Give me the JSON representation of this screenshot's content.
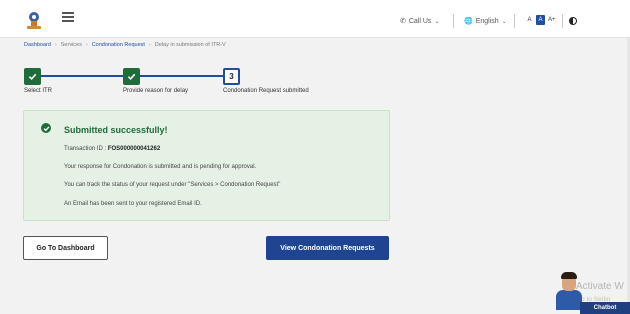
{
  "header": {
    "call_us": "Call Us",
    "language": "English",
    "font_sizes": [
      "A",
      "A",
      "A+"
    ]
  },
  "breadcrumb": [
    "Dashboard",
    "Services",
    "Condonation Request",
    "Delay in submission of ITR-V"
  ],
  "stepper": {
    "steps": [
      {
        "label": "Select ITR",
        "status": "done"
      },
      {
        "label": "Provide reason for delay",
        "status": "done"
      },
      {
        "label": "Condonation Request submitted",
        "status": "current",
        "number": "3"
      }
    ]
  },
  "success": {
    "title": "Submitted successfully!",
    "transaction_label": "Transaction ID :",
    "transaction_id": "FOS000000041262",
    "line1": "Your response for Condonation is submitted and is pending for approval.",
    "line2": "You can track the status of your request under \"Services > Condonation Request\"",
    "line3": "An Email has been sent to your registered Email ID."
  },
  "buttons": {
    "dashboard": "Go To Dashboard",
    "view_requests": "View Condonation Requests"
  },
  "chatbot": {
    "label": "Chatbot"
  },
  "watermark": {
    "line1": "Activate W",
    "line2": "Go to Settin"
  },
  "colors": {
    "primary": "#1f4592",
    "success": "#1f6b3a",
    "panel_bg": "#e6f1e6"
  }
}
